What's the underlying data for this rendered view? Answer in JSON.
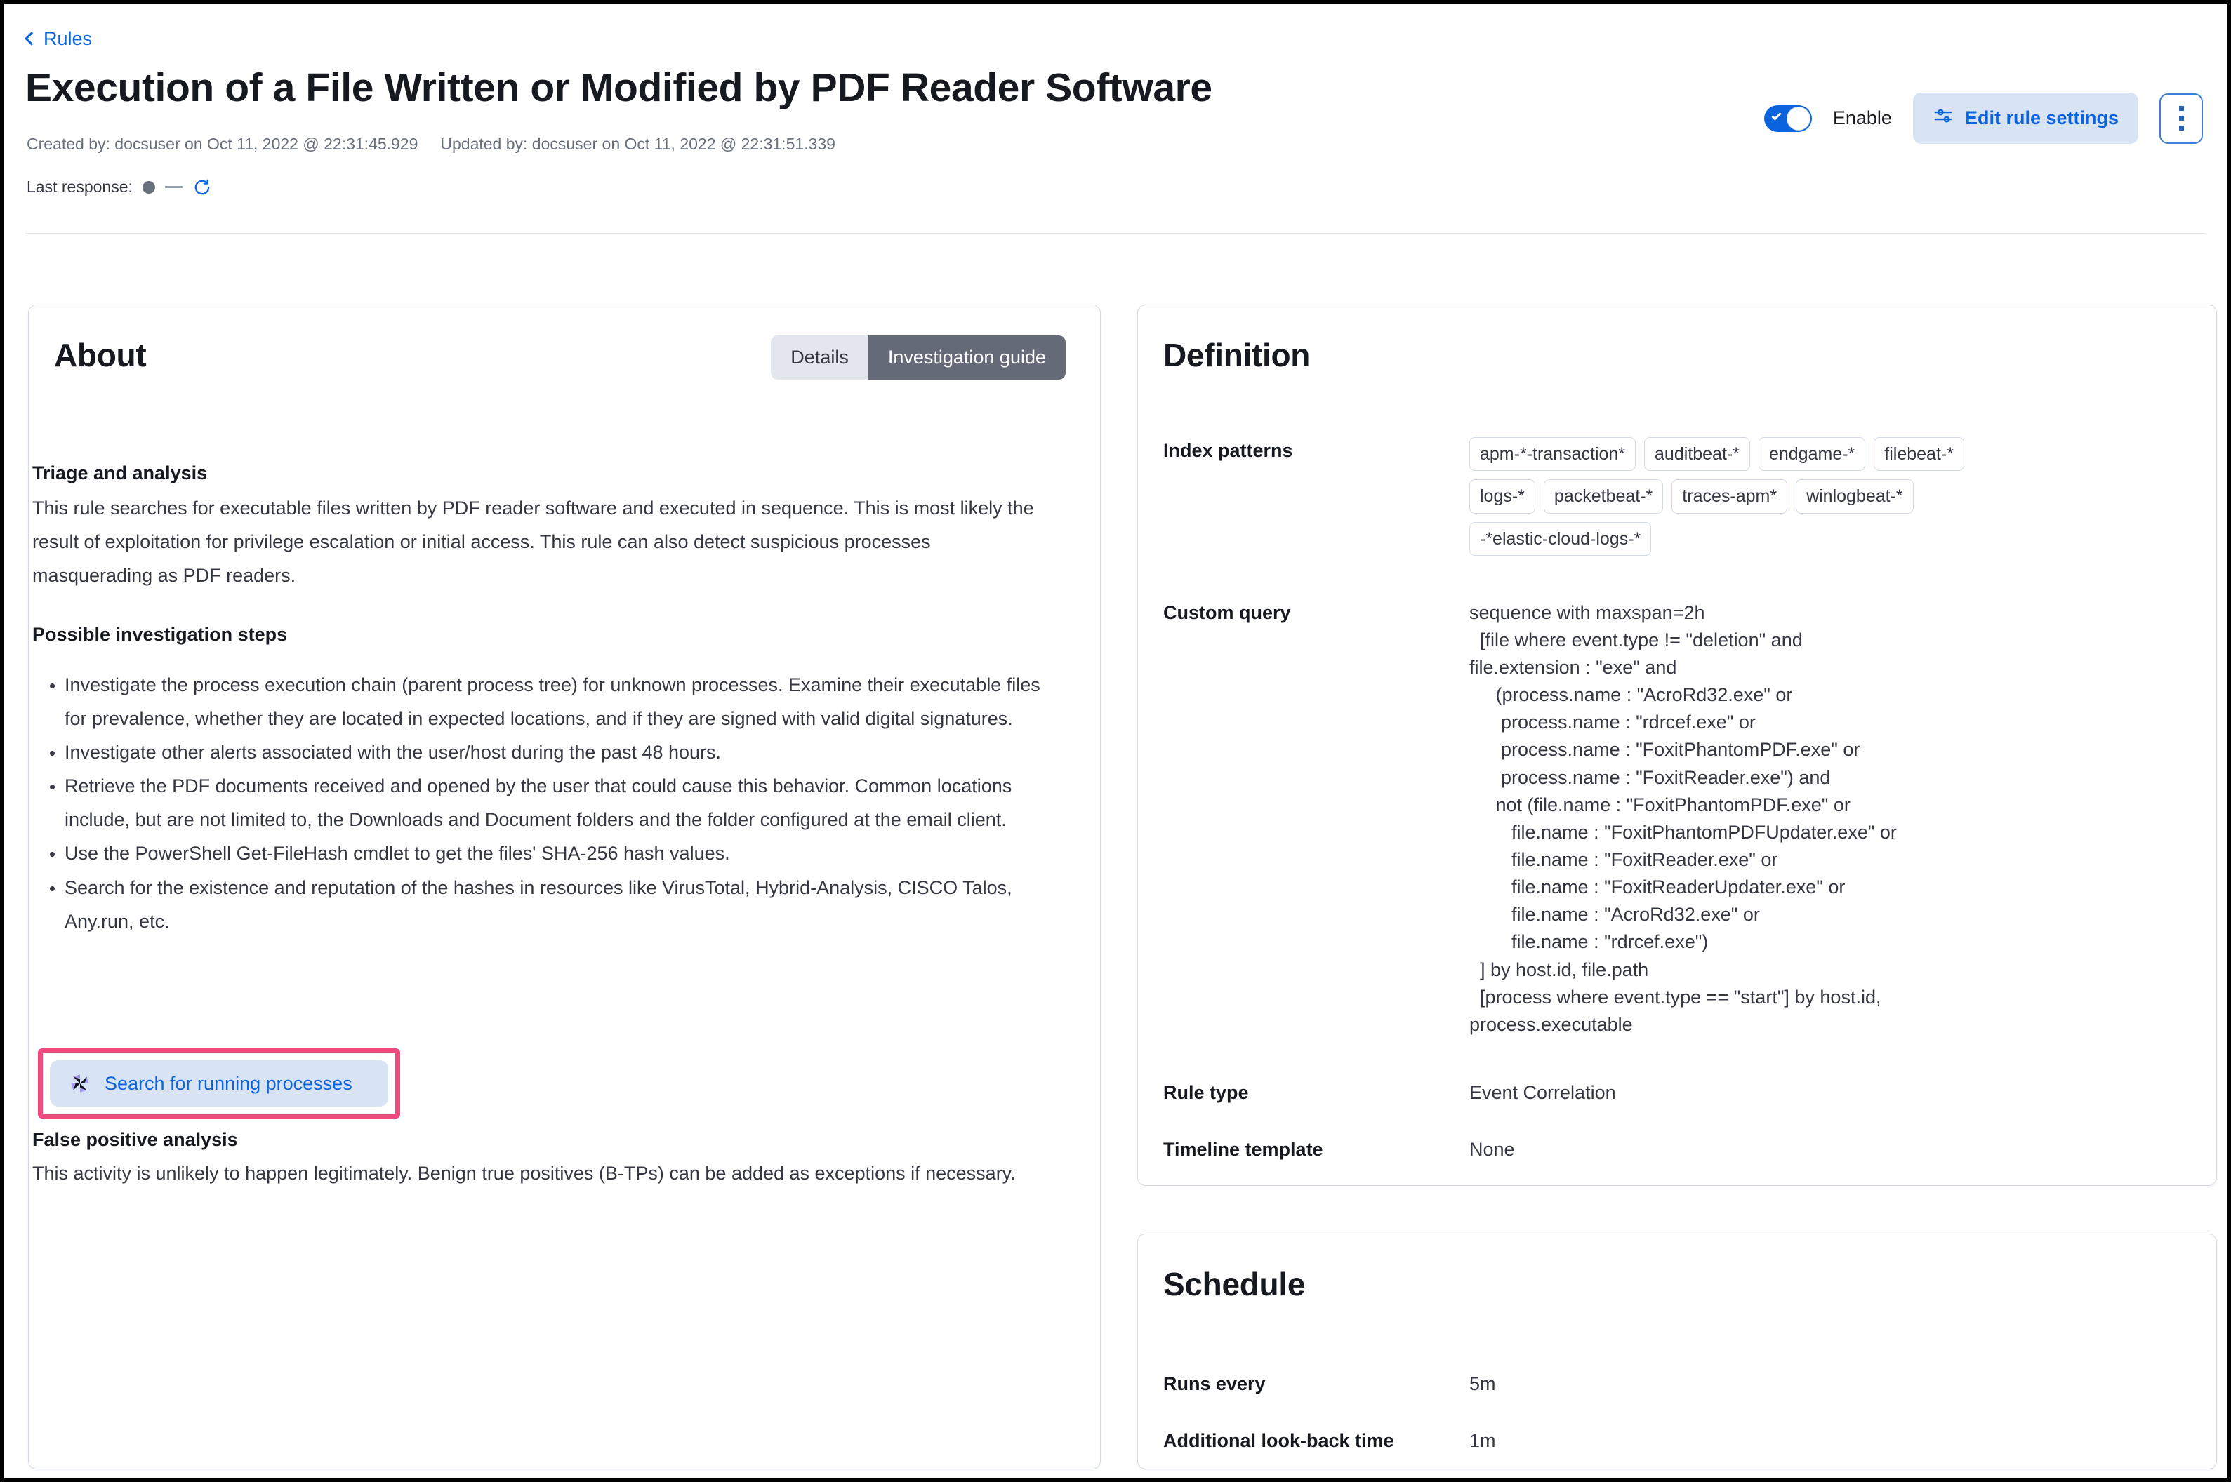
{
  "breadcrumb": {
    "label": "Rules",
    "icon": "chevron-left-icon"
  },
  "header": {
    "title": "Execution of a File Written or Modified by PDF Reader Software",
    "created_by": "Created by: docsuser on Oct 11, 2022 @ 22:31:45.929",
    "updated_by": "Updated by: docsuser on Oct 11, 2022 @ 22:31:51.339",
    "last_response_label": "Last response:",
    "last_response_value": "—",
    "enable_label": "Enable",
    "enable_state": "on",
    "edit_rule_settings_label": "Edit rule settings",
    "more_actions_label": "",
    "accent_color": "#0b64dd"
  },
  "about": {
    "title": "About",
    "tabs": [
      {
        "label": "Details",
        "active": false
      },
      {
        "label": "Investigation guide",
        "active": true
      }
    ],
    "triage_heading": "Triage and analysis",
    "triage_text": "This rule searches for executable files written by PDF reader software and executed in sequence. This is most likely the result of exploitation for privilege escalation or initial access. This rule can also detect suspicious processes masquerading as PDF readers.",
    "steps_heading": "Possible investigation steps",
    "steps": [
      "Investigate the process execution chain (parent process tree) for unknown processes. Examine their executable files for prevalence, whether they are located in expected locations, and if they are signed with valid digital signatures.",
      "Investigate other alerts associated with the user/host during the past 48 hours.",
      "Retrieve the PDF documents received and opened by the user that could cause this behavior. Common locations include, but are not limited to, the Downloads and Document folders and the folder configured at the email client.",
      "Use the PowerShell Get-FileHash cmdlet to get the files' SHA-256 hash values.",
      "Search for the existence and reputation of the hashes in resources like VirusTotal, Hybrid-Analysis, CISCO Talos, Any.run, etc."
    ],
    "osquery_button_label": "Search for running processes",
    "osquery_icon": "osquery-pinwheel-icon",
    "highlight_color": "#ee4a7b",
    "false_positive_heading": "False positive analysis",
    "false_positive_text": "This activity is unlikely to happen legitimately. Benign true positives (B-TPs) can be added as exceptions if necessary."
  },
  "definition": {
    "title": "Definition",
    "index_patterns_label": "Index patterns",
    "index_patterns": [
      "apm-*-transaction*",
      "auditbeat-*",
      "endgame-*",
      "filebeat-*",
      "logs-*",
      "packetbeat-*",
      "traces-apm*",
      "winlogbeat-*",
      "-*elastic-cloud-logs-*"
    ],
    "custom_query_label": "Custom query",
    "custom_query": "sequence with maxspan=2h\n  [file where event.type != \"deletion\" and\nfile.extension : \"exe\" and\n     (process.name : \"AcroRd32.exe\" or\n      process.name : \"rdrcef.exe\" or\n      process.name : \"FoxitPhantomPDF.exe\" or\n      process.name : \"FoxitReader.exe\") and\n     not (file.name : \"FoxitPhantomPDF.exe\" or\n        file.name : \"FoxitPhantomPDFUpdater.exe\" or\n        file.name : \"FoxitReader.exe\" or\n        file.name : \"FoxitReaderUpdater.exe\" or\n        file.name : \"AcroRd32.exe\" or\n        file.name : \"rdrcef.exe\")\n  ] by host.id, file.path\n  [process where event.type == \"start\"] by host.id,\nprocess.executable",
    "rule_type_label": "Rule type",
    "rule_type_value": "Event Correlation",
    "timeline_template_label": "Timeline template",
    "timeline_template_value": "None"
  },
  "schedule": {
    "title": "Schedule",
    "runs_every_label": "Runs every",
    "runs_every_value": "5m",
    "lookback_label": "Additional look-back time",
    "lookback_value": "1m"
  }
}
